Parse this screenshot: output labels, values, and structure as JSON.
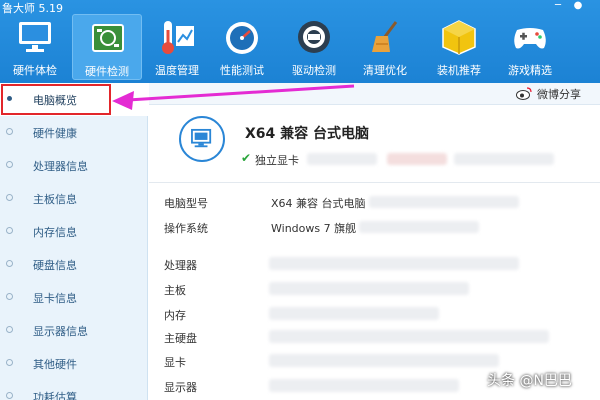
{
  "app": {
    "title": "鲁大师 5.19"
  },
  "toolbar": {
    "items": [
      {
        "label": "硬件体检"
      },
      {
        "label": "硬件检测"
      },
      {
        "label": "温度管理"
      },
      {
        "label": "性能测试"
      },
      {
        "label": "驱动检测"
      },
      {
        "label": "清理优化"
      },
      {
        "label": "装机推荐"
      },
      {
        "label": "游戏精选"
      }
    ],
    "active_index": 1
  },
  "sidebar": {
    "items": [
      {
        "label": "电脑概览"
      },
      {
        "label": "硬件健康"
      },
      {
        "label": "处理器信息"
      },
      {
        "label": "主板信息"
      },
      {
        "label": "内存信息"
      },
      {
        "label": "硬盘信息"
      },
      {
        "label": "显卡信息"
      },
      {
        "label": "显示器信息"
      },
      {
        "label": "其他硬件"
      },
      {
        "label": "功耗估算"
      }
    ],
    "active_index": 0
  },
  "share": {
    "label": "微博分享"
  },
  "summary": {
    "title": "X64 兼容 台式电脑",
    "gpu_tag": "独立显卡"
  },
  "details": [
    {
      "label": "电脑型号",
      "value": "X64 兼容 台式电脑"
    },
    {
      "label": "操作系统",
      "value": "Windows 7 旗舰"
    },
    {
      "label": "处理器",
      "value": ""
    },
    {
      "label": "主板",
      "value": ""
    },
    {
      "label": "内存",
      "value": ""
    },
    {
      "label": "主硬盘",
      "value": ""
    },
    {
      "label": "显卡",
      "value": ""
    },
    {
      "label": "显示器",
      "value": ""
    }
  ],
  "watermark": "头条 @N巴巴",
  "colors": {
    "header": "#1c82d4",
    "highlight": "#e2262b",
    "arrow": "#e42bd3"
  }
}
